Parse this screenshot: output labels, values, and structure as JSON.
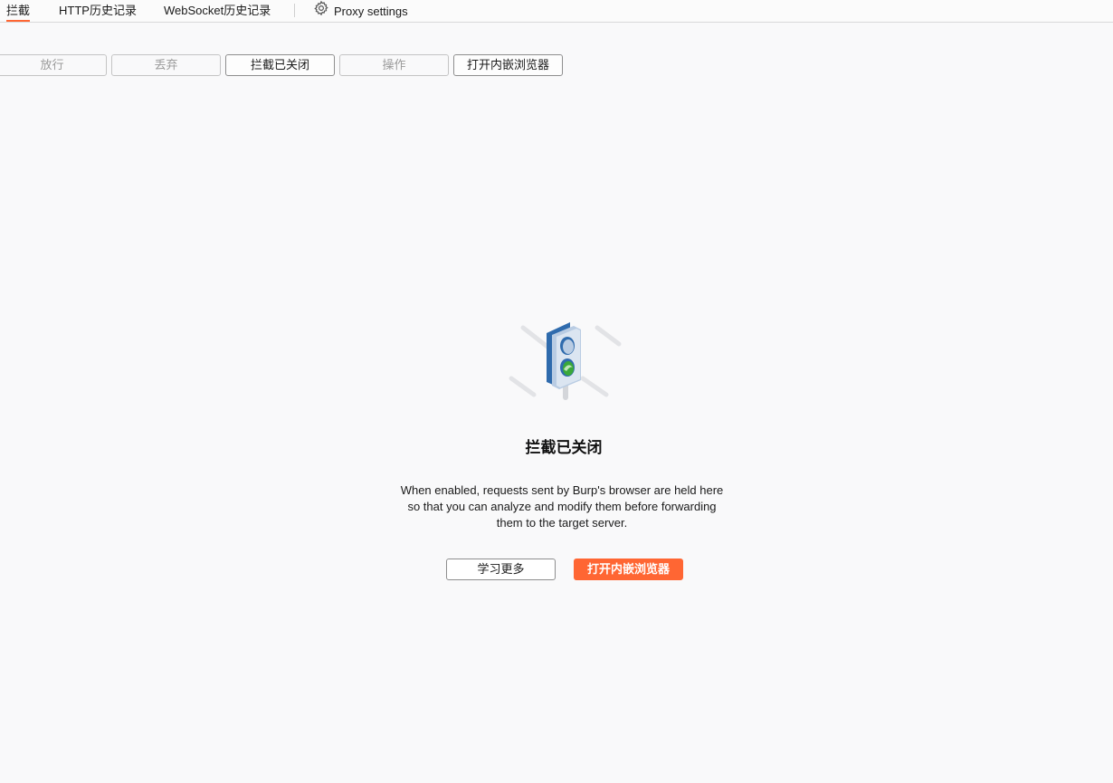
{
  "tabs": [
    {
      "label": "拦截",
      "active": true
    },
    {
      "label": "HTTP历史记录",
      "active": false
    },
    {
      "label": "WebSocket历史记录",
      "active": false
    },
    {
      "label": "Proxy settings",
      "icon": "gear-icon",
      "active": false
    }
  ],
  "toolbar": {
    "forward_label": "放行",
    "drop_label": "丢弃",
    "intercept_toggle_label": "拦截已关闭",
    "action_label": "操作",
    "open_browser_label": "打开内嵌浏览器"
  },
  "empty_state": {
    "illustration": "traffic-light-icon",
    "title": "拦截已关闭",
    "description_lines": [
      "When enabled, requests sent by Burp's browser are held here",
      "so that you can analyze and modify them before forwarding",
      "them to the target server."
    ],
    "learn_more_label": "学习更多",
    "open_browser_label": "打开内嵌浏览器"
  },
  "colors": {
    "accent": "#ff6633",
    "background": "#f9f9fa",
    "light_blue": "#2f6bad",
    "light_green": "#3aa83a"
  }
}
